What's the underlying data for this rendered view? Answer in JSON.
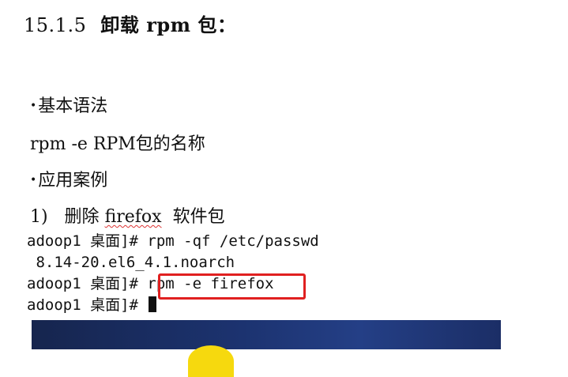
{
  "heading": {
    "number": "15.1.5",
    "title": "卸载 rpm 包："
  },
  "bullet_symbol": "•",
  "basic_syntax": {
    "label": "基本语法"
  },
  "syntax_line": "rpm -e RPM包的名称",
  "application_cases": {
    "label": "应用案例"
  },
  "case_1": {
    "prefix": "1)   删除 ",
    "package": "firefox",
    "suffix": "  软件包"
  },
  "terminal": {
    "lines": [
      "adoop1 桌面]# rpm -qf /etc/passwd",
      " 8.14-20.el6_4.1.noarch",
      "adoop1 桌面]# rpm -e firefox",
      "adoop1 桌面]# "
    ]
  },
  "colors": {
    "highlight_box": "#e02020",
    "desktop_bg": "#1c3370",
    "sun": "#f6d90e"
  }
}
